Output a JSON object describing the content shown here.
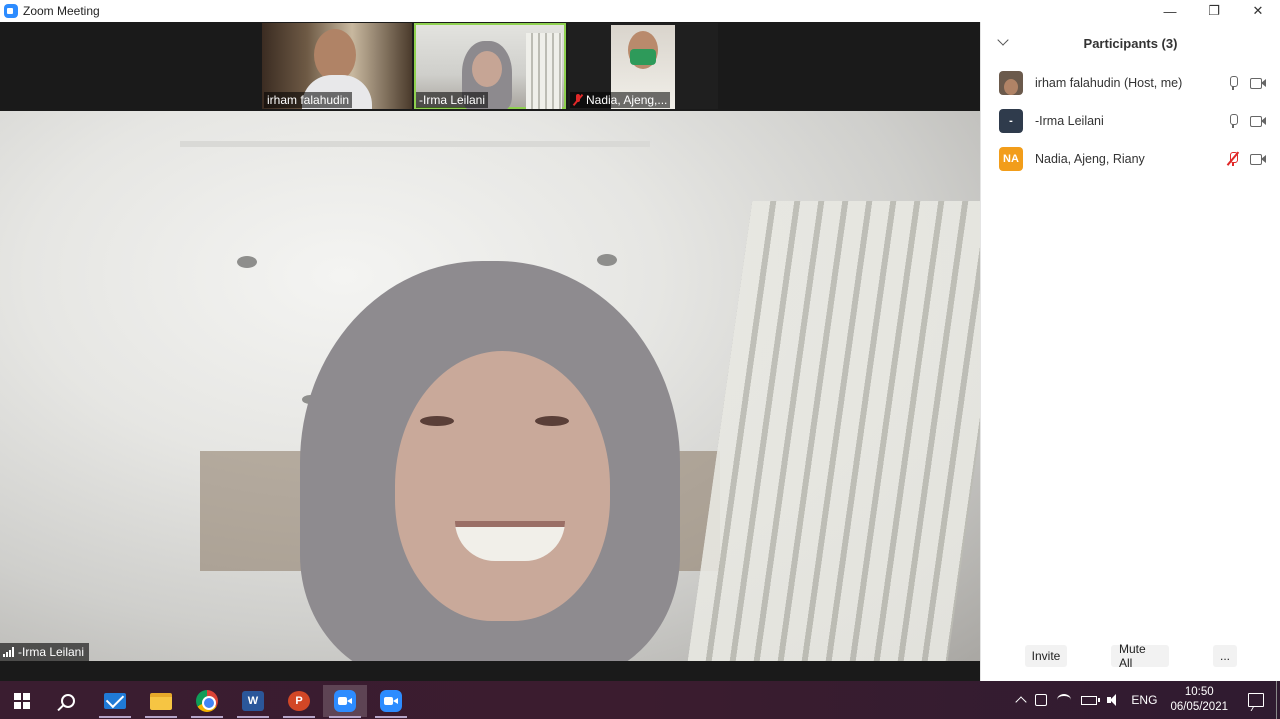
{
  "window": {
    "title": "Zoom Meeting",
    "controls": {
      "minimize": "—",
      "restore": "❐",
      "close": "✕"
    }
  },
  "thumbnails": [
    {
      "name": "irham falahudin",
      "muted": false,
      "active": false
    },
    {
      "name": "-Irma Leilani",
      "muted": false,
      "active": true
    },
    {
      "name": "Nadia, Ajeng,...",
      "muted": true,
      "active": false
    }
  ],
  "main_video": {
    "speaker_name": "-Irma Leilani"
  },
  "participants_panel": {
    "title": "Participants (3)",
    "participants": [
      {
        "name": "irham falahudin (Host, me)",
        "avatar_text": "",
        "avatar_color": "#6b5a4c",
        "mic_muted": false
      },
      {
        "name": "-Irma Leilani",
        "avatar_text": "-",
        "avatar_color": "#2f3b4c",
        "mic_muted": false
      },
      {
        "name": "Nadia, Ajeng, Riany",
        "avatar_text": "NA",
        "avatar_color": "#f29d1a",
        "mic_muted": true
      }
    ],
    "footer": {
      "invite_label": "Invite",
      "mute_all_label": "Mute All",
      "more_label": "..."
    }
  },
  "taskbar": {
    "apps": [
      {
        "name": "start",
        "icon": "windows-logo-icon"
      },
      {
        "name": "search",
        "icon": "search-icon"
      },
      {
        "name": "mail",
        "icon": "mail-icon"
      },
      {
        "name": "file-explorer",
        "icon": "folder-icon"
      },
      {
        "name": "chrome",
        "icon": "chrome-icon"
      },
      {
        "name": "word",
        "icon": "word-icon",
        "letter": "W"
      },
      {
        "name": "powerpoint",
        "icon": "powerpoint-icon",
        "letter": "P"
      },
      {
        "name": "zoom-meeting",
        "icon": "zoom-icon"
      },
      {
        "name": "zoom",
        "icon": "zoom-icon"
      }
    ],
    "tray": {
      "language": "ENG",
      "time": "10:50",
      "date": "06/05/2021"
    }
  },
  "colors": {
    "zoom_blue": "#2d8cff",
    "active_border": "#8fd14f",
    "muted_red": "#e02828"
  }
}
